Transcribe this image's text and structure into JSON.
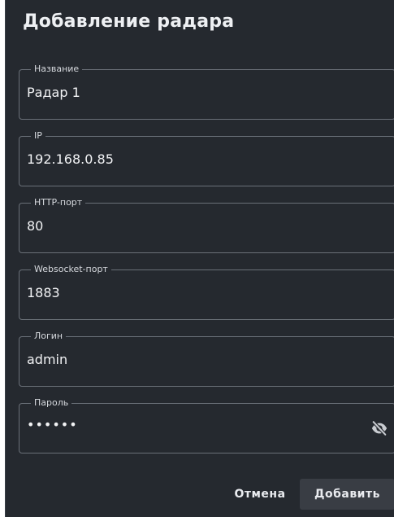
{
  "dialog": {
    "title": "Добавление радара"
  },
  "fields": {
    "name": {
      "label": "Название",
      "value": "Радар 1"
    },
    "ip": {
      "label": "IP",
      "value": "192.168.0.85"
    },
    "http_port": {
      "label": "HTTP-порт",
      "value": "80"
    },
    "websocket_port": {
      "label": "Websocket-порт",
      "value": "1883"
    },
    "login": {
      "label": "Логин",
      "value": "admin"
    },
    "password": {
      "label": "Пароль",
      "value": "••••••",
      "toggle_icon": "eye-off-icon"
    }
  },
  "actions": {
    "cancel_label": "Отмена",
    "add_label": "Добавить"
  }
}
